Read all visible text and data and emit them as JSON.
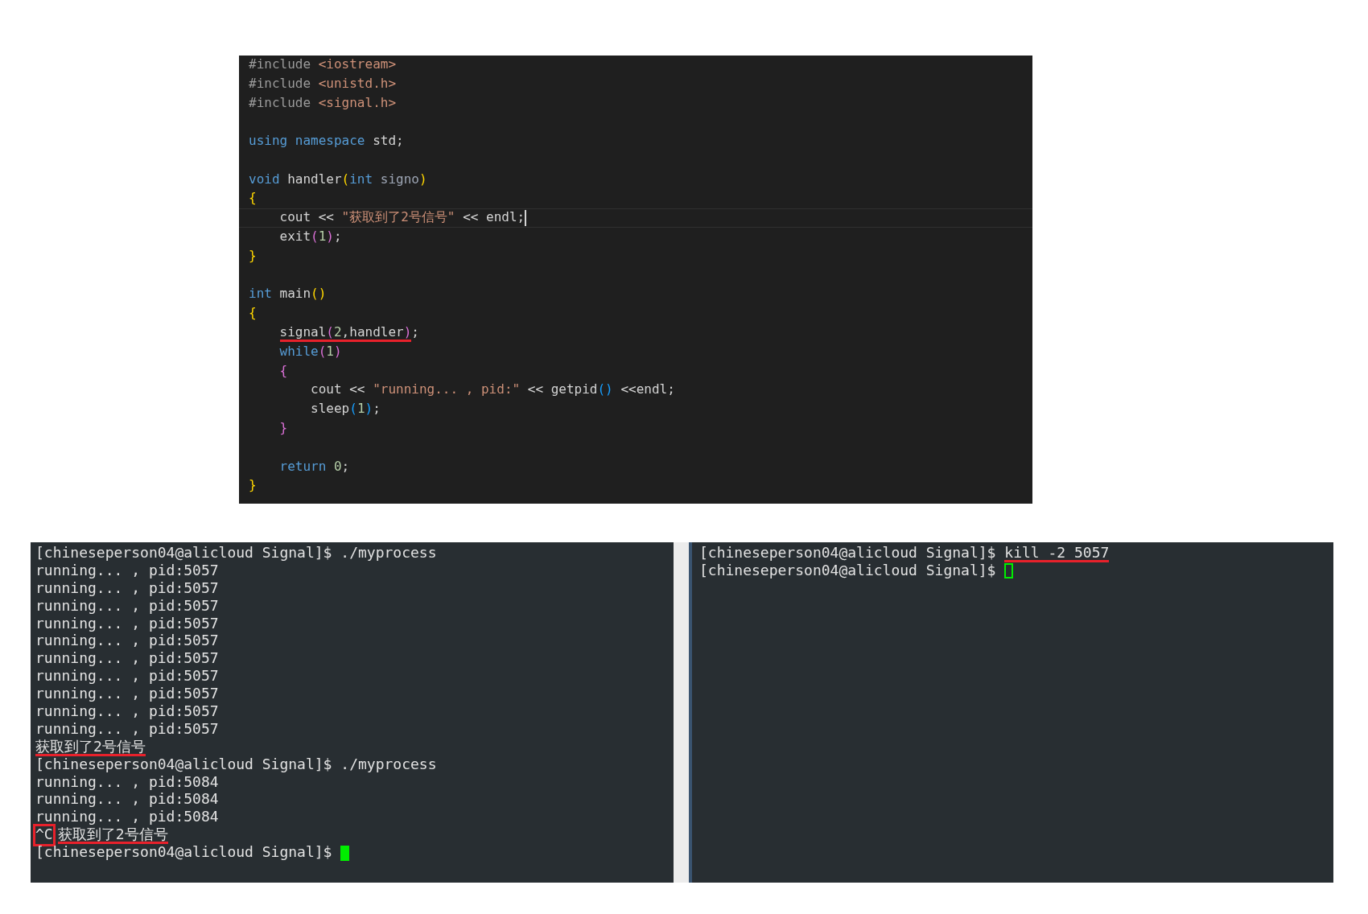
{
  "editor": {
    "lines": [
      {
        "kind": "code",
        "tokens": [
          {
            "text": "#include ",
            "kind": "pre"
          },
          {
            "text": "<iostream>",
            "kind": "str"
          }
        ]
      },
      {
        "kind": "code",
        "tokens": [
          {
            "text": "#include ",
            "kind": "pre"
          },
          {
            "text": "<unistd.h>",
            "kind": "str"
          }
        ]
      },
      {
        "kind": "code",
        "tokens": [
          {
            "text": "#include ",
            "kind": "pre"
          },
          {
            "text": "<signal.h>",
            "kind": "str"
          }
        ]
      },
      {
        "kind": "blank"
      },
      {
        "kind": "code",
        "tokens": [
          {
            "text": "using namespace",
            "kind": "kw"
          },
          {
            "text": " std;",
            "kind": "plain"
          }
        ]
      },
      {
        "kind": "blank"
      },
      {
        "kind": "code",
        "tokens": [
          {
            "text": "void",
            "kind": "kw"
          },
          {
            "text": " handler",
            "kind": "plain"
          },
          {
            "text": "(",
            "kind": "b1"
          },
          {
            "text": "int",
            "kind": "kw"
          },
          {
            "text": " signo",
            "kind": "param"
          },
          {
            "text": ")",
            "kind": "b1"
          }
        ]
      },
      {
        "kind": "code",
        "tokens": [
          {
            "text": "{",
            "kind": "b1"
          }
        ]
      },
      {
        "kind": "code",
        "current": true,
        "tokens": [
          {
            "text": "    cout << ",
            "kind": "plain"
          },
          {
            "text": "\"获取到了2号信号\"",
            "kind": "str"
          },
          {
            "text": " << endl;",
            "kind": "plain"
          }
        ]
      },
      {
        "kind": "code",
        "tokens": [
          {
            "text": "    exit",
            "kind": "plain"
          },
          {
            "text": "(",
            "kind": "b2"
          },
          {
            "text": "1",
            "kind": "num"
          },
          {
            "text": ")",
            "kind": "b2"
          },
          {
            "text": ";",
            "kind": "plain"
          }
        ]
      },
      {
        "kind": "code",
        "tokens": [
          {
            "text": "}",
            "kind": "b1"
          }
        ]
      },
      {
        "kind": "blank"
      },
      {
        "kind": "code",
        "tokens": [
          {
            "text": "int",
            "kind": "kw"
          },
          {
            "text": " main",
            "kind": "plain"
          },
          {
            "text": "()",
            "kind": "b1"
          }
        ]
      },
      {
        "kind": "code",
        "tokens": [
          {
            "text": "{",
            "kind": "b1"
          }
        ]
      },
      {
        "kind": "code",
        "tokens": [
          {
            "text": "    signal",
            "kind": "plain",
            "underlined": true
          },
          {
            "text": "(",
            "kind": "b2",
            "underlined": true
          },
          {
            "text": "2",
            "kind": "num",
            "underlined": true
          },
          {
            "text": ",handler",
            "kind": "plain",
            "underlined": true
          },
          {
            "text": ")",
            "kind": "b2",
            "underlined": true
          },
          {
            "text": ";",
            "kind": "plain"
          }
        ]
      },
      {
        "kind": "code",
        "tokens": [
          {
            "text": "    while",
            "kind": "kw"
          },
          {
            "text": "(",
            "kind": "b2"
          },
          {
            "text": "1",
            "kind": "num"
          },
          {
            "text": ")",
            "kind": "b2"
          }
        ]
      },
      {
        "kind": "code",
        "tokens": [
          {
            "text": "    {",
            "kind": "b2"
          }
        ]
      },
      {
        "kind": "code",
        "tokens": [
          {
            "text": "        cout << ",
            "kind": "plain"
          },
          {
            "text": "\"running... , pid:\"",
            "kind": "str"
          },
          {
            "text": " << getpid",
            "kind": "plain"
          },
          {
            "text": "()",
            "kind": "b3"
          },
          {
            "text": " <<endl;",
            "kind": "plain"
          }
        ]
      },
      {
        "kind": "code",
        "tokens": [
          {
            "text": "        sleep",
            "kind": "plain"
          },
          {
            "text": "(",
            "kind": "b3"
          },
          {
            "text": "1",
            "kind": "num"
          },
          {
            "text": ")",
            "kind": "b3"
          },
          {
            "text": ";",
            "kind": "plain"
          }
        ]
      },
      {
        "kind": "code",
        "tokens": [
          {
            "text": "    }",
            "kind": "b2"
          }
        ]
      },
      {
        "kind": "blank"
      },
      {
        "kind": "code",
        "tokens": [
          {
            "text": "    return",
            "kind": "kw"
          },
          {
            "text": " 0",
            "kind": "num"
          },
          {
            "text": ";",
            "kind": "plain"
          }
        ]
      },
      {
        "kind": "code",
        "tokens": [
          {
            "text": "}",
            "kind": "b1"
          }
        ]
      }
    ]
  },
  "terminals": [
    {
      "cursor": {
        "filled": true
      },
      "lines": [
        {
          "tokens": [
            {
              "text": "[chineseperson04@alicloud Signal]$ ./myprocess"
            }
          ]
        },
        {
          "tokens": [
            {
              "text": "running... , pid:5057"
            }
          ]
        },
        {
          "tokens": [
            {
              "text": "running... , pid:5057"
            }
          ]
        },
        {
          "tokens": [
            {
              "text": "running... , pid:5057"
            }
          ]
        },
        {
          "tokens": [
            {
              "text": "running... , pid:5057"
            }
          ]
        },
        {
          "tokens": [
            {
              "text": "running... , pid:5057"
            }
          ]
        },
        {
          "tokens": [
            {
              "text": "running... , pid:5057"
            }
          ]
        },
        {
          "tokens": [
            {
              "text": "running... , pid:5057"
            }
          ]
        },
        {
          "tokens": [
            {
              "text": "running... , pid:5057"
            }
          ]
        },
        {
          "tokens": [
            {
              "text": "running... , pid:5057"
            }
          ]
        },
        {
          "tokens": [
            {
              "text": "running... , pid:5057"
            }
          ]
        },
        {
          "tokens": [
            {
              "text": "获取到了2号信号",
              "underlined": true
            }
          ]
        },
        {
          "tokens": [
            {
              "text": "[chineseperson04@alicloud Signal]$ ./myprocess"
            }
          ]
        },
        {
          "tokens": [
            {
              "text": "running... , pid:5084"
            }
          ]
        },
        {
          "tokens": [
            {
              "text": "running... , pid:5084"
            }
          ]
        },
        {
          "tokens": [
            {
              "text": "running... , pid:5084"
            }
          ]
        },
        {
          "tokens": [
            {
              "text": "^C",
              "boxed": true
            },
            {
              "text": "获取到了2号信号",
              "underlined": true
            }
          ]
        },
        {
          "tokens": [
            {
              "text": "[chineseperson04@alicloud Signal]$ "
            }
          ]
        }
      ]
    },
    {
      "cursor": {
        "filled": false
      },
      "lines": [
        {
          "tokens": [
            {
              "text": "[chineseperson04@alicloud Signal]$ "
            },
            {
              "text": "kill -2 5057",
              "underlined": true
            }
          ]
        },
        {
          "tokens": [
            {
              "text": "[chineseperson04@alicloud Signal]$ "
            }
          ]
        }
      ]
    }
  ]
}
